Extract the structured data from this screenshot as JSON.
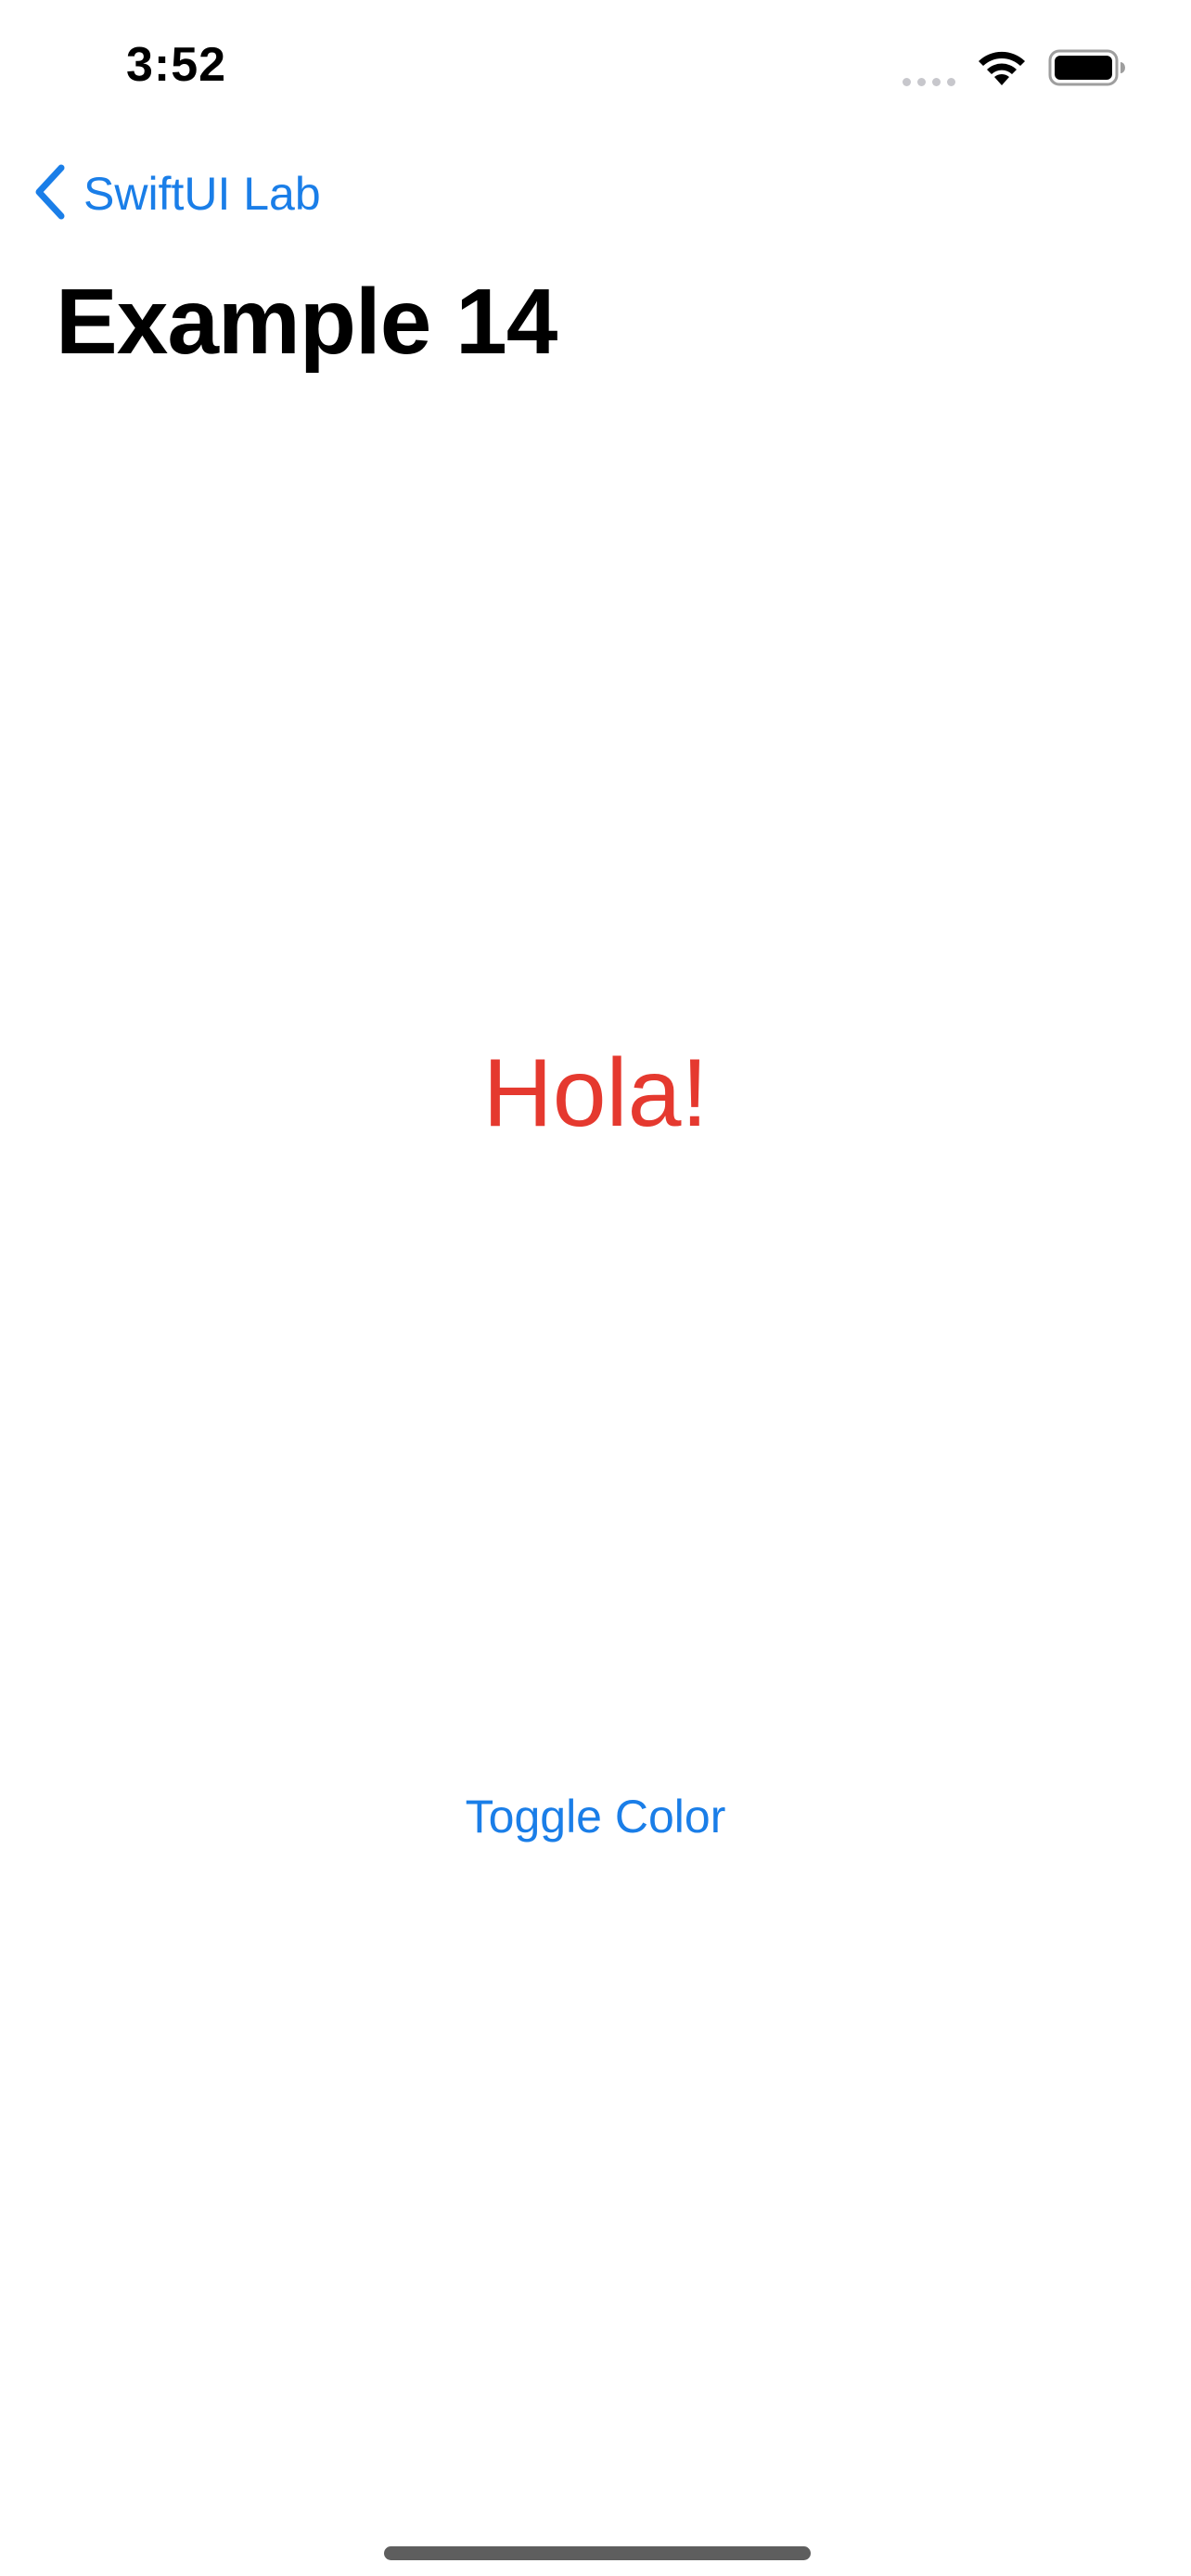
{
  "status_bar": {
    "time": "3:52",
    "icons": [
      "signal-icon",
      "wifi-icon",
      "battery-icon"
    ]
  },
  "navigation": {
    "back_label": "SwiftUI Lab",
    "back_icon": "chevron-left-icon",
    "title": "Example 14"
  },
  "content": {
    "greeting": "Hola!",
    "greeting_color": "#e5392f",
    "toggle_label": "Toggle Color"
  },
  "colors": {
    "accent": "#1a7ee8",
    "background": "#ffffff",
    "title": "#000000"
  }
}
